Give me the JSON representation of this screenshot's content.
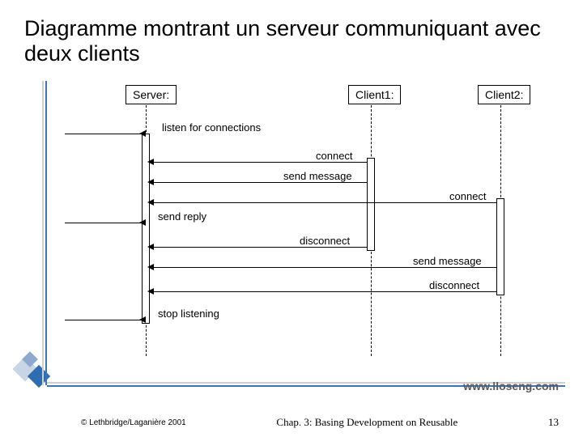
{
  "title": "Diagramme montrant un serveur communiquant avec deux clients",
  "lifelines": {
    "server": "Server:",
    "client1": "Client1:",
    "client2": "Client2:"
  },
  "messages": {
    "listen": "listen for connections",
    "connect1": "connect",
    "sendmsg1": "send message",
    "connect2": "connect",
    "sendreply": "send reply",
    "disconnect1": "disconnect",
    "sendmsg2": "send message",
    "disconnect2": "disconnect",
    "stop": "stop listening"
  },
  "url": "www.lloseng.com",
  "footer": {
    "copyright": "© Lethbridge/Laganière 2001",
    "chapter": "Chap. 3: Basing Development on Reusable",
    "page": "13"
  }
}
